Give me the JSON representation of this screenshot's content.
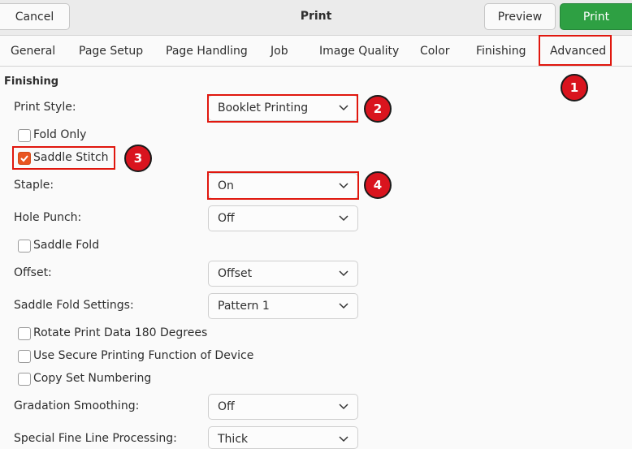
{
  "header": {
    "cancel_label": "Cancel",
    "title": "Print",
    "preview_label": "Preview",
    "print_label": "Print",
    "print_color": "#2ea043"
  },
  "tabs": [
    {
      "label": "General"
    },
    {
      "label": "Page Setup"
    },
    {
      "label": "Page Handling"
    },
    {
      "label": "Job"
    },
    {
      "label": "Image Quality"
    },
    {
      "label": "Color"
    },
    {
      "label": "Finishing"
    },
    {
      "label": "Advanced"
    }
  ],
  "section": {
    "title": "Finishing"
  },
  "fields": {
    "print_style": {
      "label": "Print Style:",
      "value": "Booklet Printing"
    },
    "staple": {
      "label": "Staple:",
      "value": "On"
    },
    "hole_punch": {
      "label": "Hole Punch:",
      "value": "Off"
    },
    "offset": {
      "label": "Offset:",
      "value": "Offset"
    },
    "saddle_fold_settings": {
      "label": "Saddle Fold Settings:",
      "value": "Pattern 1"
    },
    "gradation_smoothing": {
      "label": "Gradation Smoothing:",
      "value": "Off"
    },
    "special_fine_line": {
      "label": "Special Fine Line Processing:",
      "value": "Thick"
    }
  },
  "checkboxes": {
    "fold_only": {
      "label": "Fold Only",
      "checked": false
    },
    "saddle_stitch": {
      "label": "Saddle Stitch",
      "checked": true
    },
    "saddle_fold": {
      "label": "Saddle Fold",
      "checked": false
    },
    "rotate": {
      "label": "Rotate Print Data 180 Degrees",
      "checked": false
    },
    "secure": {
      "label": "Use Secure Printing Function of Device",
      "checked": false
    },
    "copy_set": {
      "label": "Copy Set Numbering",
      "checked": false
    }
  },
  "annotations": {
    "one": "1",
    "two": "2",
    "three": "3",
    "four": "4",
    "highlight_color": "#e0170e"
  }
}
